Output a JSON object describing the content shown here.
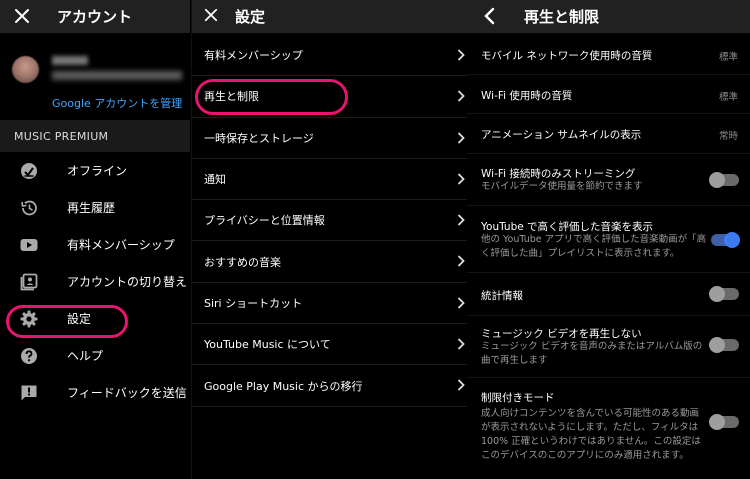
{
  "account_panel": {
    "title": "アカウント",
    "manage_link": "Google アカウントを管理",
    "section_label": "MUSIC PREMIUM",
    "items": [
      {
        "label": "オフライン",
        "icon": "offline-icon"
      },
      {
        "label": "再生履歴",
        "icon": "history-icon"
      },
      {
        "label": "有料メンバーシップ",
        "icon": "youtube-icon"
      },
      {
        "label": "アカウントの切り替え",
        "icon": "switch-account-icon"
      },
      {
        "label": "設定",
        "icon": "gear-icon"
      },
      {
        "label": "ヘルプ",
        "icon": "help-icon"
      },
      {
        "label": "フィードバックを送信",
        "icon": "feedback-icon"
      }
    ]
  },
  "settings_panel": {
    "title": "設定",
    "items": [
      {
        "label": "有料メンバーシップ"
      },
      {
        "label": "再生と制限"
      },
      {
        "label": "一時保存とストレージ"
      },
      {
        "label": "通知"
      },
      {
        "label": "プライバシーと位置情報"
      },
      {
        "label": "おすすめの音楽"
      },
      {
        "label": "Siri ショートカット"
      },
      {
        "label": "YouTube Music について"
      },
      {
        "label": "Google Play Music からの移行"
      }
    ]
  },
  "playback_panel": {
    "title": "再生と制限",
    "items": [
      {
        "label": "モバイル ネットワーク使用時の音質",
        "value": "標準"
      },
      {
        "label": "Wi-Fi 使用時の音質",
        "value": "標準"
      },
      {
        "label": "アニメーション サムネイルの表示",
        "value": "常時"
      },
      {
        "label": "Wi-Fi 接続時のみストリーミング",
        "desc": [
          "モバイルデータ使用量を節約できます"
        ],
        "toggle_on": false
      },
      {
        "label": "YouTube で高く評価した音楽を表示",
        "desc": [
          "他の YouTube アプリで高く評価した音楽動画が「高",
          "く評価した曲」プレイリストに表示されます。"
        ],
        "toggle_on": true
      },
      {
        "label": "統計情報",
        "toggle_on": false
      },
      {
        "label": "ミュージック ビデオを再生しない",
        "desc": [
          "ミュージック ビデオを音声のみまたはアルバム版の",
          "曲で再生します"
        ],
        "toggle_on": false
      },
      {
        "label": "制限付きモード",
        "desc": [
          "成人向けコンテンツを含んでいる可能性のある動画",
          "が表示されないようにします。ただし、フィルタは",
          "100% 正確というわけではありません。この設定は",
          "このデバイスのこのアプリにのみ適用されます。"
        ],
        "toggle_on": false
      }
    ]
  },
  "colors": {
    "highlight_ring": "#e8146d",
    "link": "#3ea6ff",
    "toggle_on": "#3e7bf2"
  }
}
